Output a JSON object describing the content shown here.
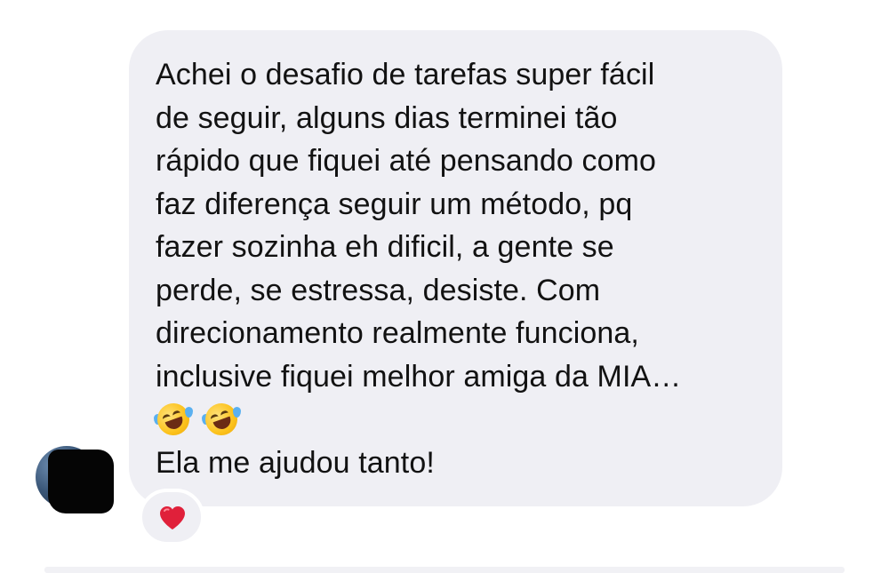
{
  "message": {
    "lines": [
      "Achei o desafio de tarefas super fácil",
      "de seguir, alguns dias terminei tão",
      "rápido que fiquei até pensando como",
      "faz diferença seguir um método, pq",
      "fazer sozinha eh dificil, a gente se",
      "perde, se estressa, desiste. Com",
      "direcionamento realmente funciona,",
      "inclusive fiquei melhor amiga da MIA…"
    ],
    "emojis": [
      "rolling-on-floor-laughing",
      "rolling-on-floor-laughing"
    ],
    "last_line": "Ela me ajudou tanto!"
  },
  "reaction": {
    "icon": "red-heart",
    "color": "#e0203a"
  },
  "colors": {
    "bubble": "#efeff4",
    "text": "#121212"
  }
}
